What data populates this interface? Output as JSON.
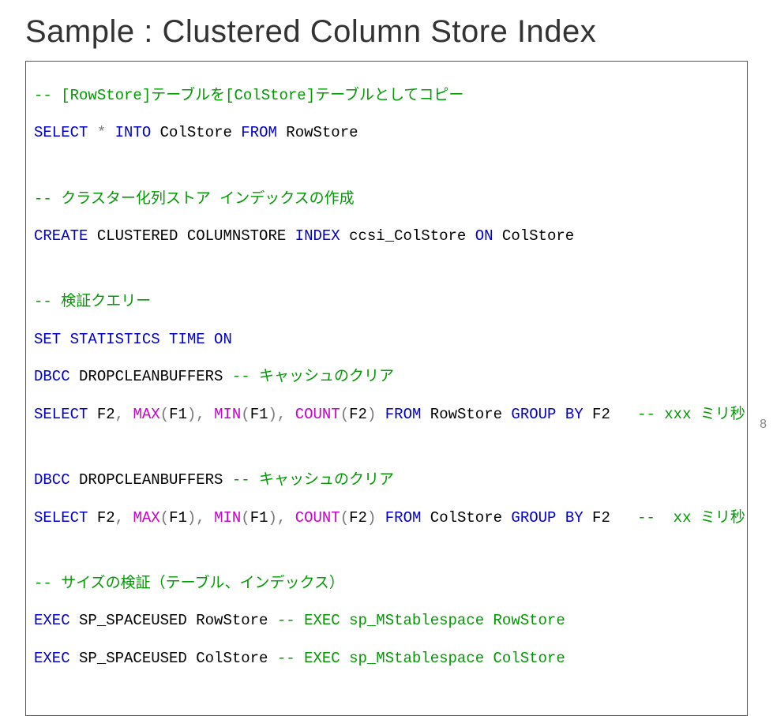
{
  "title": "Sample : Clustered Column Store Index",
  "c1": "-- [RowStore]テーブルを[ColStore]テーブルとしてコピー",
  "l1a": "SELECT",
  "l1b": " * ",
  "l1c": "INTO",
  "l1d": " ColStore ",
  "l1e": "FROM",
  "l1f": " RowStore",
  "c2": "-- クラスター化列ストア インデックスの作成",
  "l2a": "CREATE",
  "l2b": " CLUSTERED COLUMNSTORE ",
  "l2c": "INDEX",
  "l2d": " ccsi_ColStore ",
  "l2e": "ON",
  "l2f": " ColStore",
  "c3": "-- 検証クエリー",
  "l3a": "SET",
  "l3b": " STATISTICS",
  "l3c": " TIME",
  "l3d": " ON",
  "l4a": "DBCC",
  "l4b": " DROPCLEANBUFFERS ",
  "l4c": "-- キャッシュのクリア",
  "l5a": "SELECT",
  "l5b": " F2",
  "l5c": ",",
  "l5d": " MAX",
  "l5e": "(",
  "l5f": "F1",
  "l5g": ")",
  "l5h": ",",
  "l5i": " MIN",
  "l5j": "(",
  "l5k": "F1",
  "l5l": ")",
  "l5m": ",",
  "l5n": " COUNT",
  "l5o": "(",
  "l5p": "F2",
  "l5q": ")",
  "l5r": " FROM",
  "l5s": " RowStore ",
  "l5t": "GROUP",
  "l5u": " BY",
  "l5v": " F2   ",
  "l5w": "-- xxx ミリ秒",
  "l6a": "DBCC",
  "l6b": " DROPCLEANBUFFERS ",
  "l6c": "-- キャッシュのクリア",
  "l7a": "SELECT",
  "l7b": " F2",
  "l7c": ",",
  "l7d": " MAX",
  "l7e": "(",
  "l7f": "F1",
  "l7g": ")",
  "l7h": ",",
  "l7i": " MIN",
  "l7j": "(",
  "l7k": "F1",
  "l7l": ")",
  "l7m": ",",
  "l7n": " COUNT",
  "l7o": "(",
  "l7p": "F2",
  "l7q": ")",
  "l7r": " FROM",
  "l7s": " ColStore ",
  "l7t": "GROUP",
  "l7u": " BY",
  "l7v": " F2   ",
  "l7w": "--  xx ミリ秒",
  "c4": "-- サイズの検証（テーブル、インデックス）",
  "l8a": "EXEC",
  "l8b": " SP_SPACEUSED",
  "l8c": " RowStore ",
  "l8d": "-- EXEC sp_MStablespace RowStore",
  "l9a": "EXEC",
  "l9b": " SP_SPACEUSED",
  "l9c": " ColStore ",
  "l9d": "-- EXEC sp_MStablespace ColStore",
  "pagenum": "8"
}
